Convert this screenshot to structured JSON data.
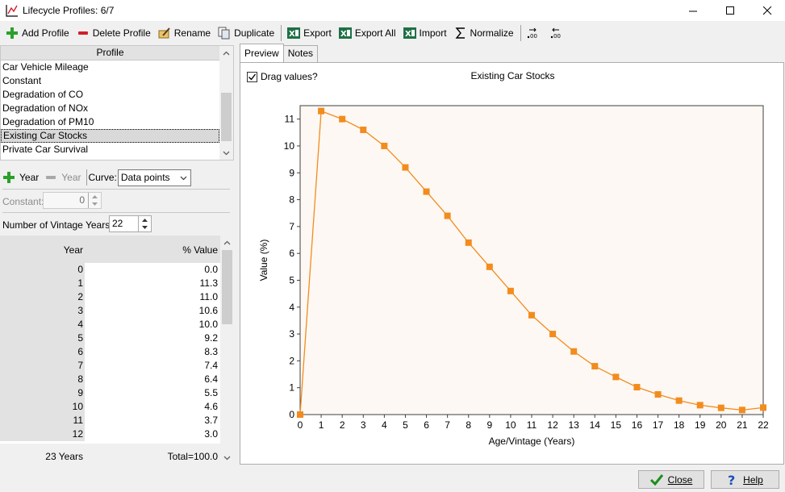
{
  "window": {
    "title": "Lifecycle Profiles: 6/7"
  },
  "toolbar": {
    "add_profile": "Add Profile",
    "delete_profile": "Delete Profile",
    "rename": "Rename",
    "duplicate": "Duplicate",
    "export": "Export",
    "export_all": "Export All",
    "import": "Import",
    "normalize": "Normalize"
  },
  "profiles": {
    "header": "Profile",
    "items": [
      "Car Vehicle Mileage",
      "Constant",
      "Degradation of CO",
      "Degradation of NOx",
      "Degradation of PM10",
      "Existing Car Stocks",
      "Private Car Survival"
    ],
    "selected": "Existing Car Stocks"
  },
  "controls": {
    "add_year": "Year",
    "remove_year": "Year",
    "curve_label": "Curve:",
    "curve_value": "Data points",
    "constant_label": "Constant:",
    "constant_value": "0",
    "vintage_label": "Number of Vintage Years:",
    "vintage_value": "22"
  },
  "table": {
    "col_year": "Year",
    "col_value": "% Value",
    "rows": [
      {
        "year": "0",
        "value": "0.0"
      },
      {
        "year": "1",
        "value": "11.3"
      },
      {
        "year": "2",
        "value": "11.0"
      },
      {
        "year": "3",
        "value": "10.6"
      },
      {
        "year": "4",
        "value": "10.0"
      },
      {
        "year": "5",
        "value": "9.2"
      },
      {
        "year": "6",
        "value": "8.3"
      },
      {
        "year": "7",
        "value": "7.4"
      },
      {
        "year": "8",
        "value": "6.4"
      },
      {
        "year": "9",
        "value": "5.5"
      },
      {
        "year": "10",
        "value": "4.6"
      },
      {
        "year": "11",
        "value": "3.7"
      },
      {
        "year": "12",
        "value": "3.0"
      }
    ],
    "footer_years": "23 Years",
    "footer_total": "Total=100.0"
  },
  "tabs": {
    "preview": "Preview",
    "notes": "Notes"
  },
  "preview": {
    "drag_values": "Drag values?",
    "drag_checked": true
  },
  "buttons": {
    "close": "Close",
    "help": "Help"
  },
  "colors": {
    "series": "#f28c1e",
    "selected_row": "#d9d9d9",
    "header_bg": "#e2e2e2"
  },
  "chart_data": {
    "type": "line",
    "title": "Existing Car Stocks",
    "xlabel": "Age/Vintage (Years)",
    "ylabel": "Value (%)",
    "x": [
      0,
      1,
      2,
      3,
      4,
      5,
      6,
      7,
      8,
      9,
      10,
      11,
      12,
      13,
      14,
      15,
      16,
      17,
      18,
      19,
      20,
      21,
      22
    ],
    "y": [
      0.0,
      11.3,
      11.0,
      10.6,
      10.0,
      9.2,
      8.3,
      7.4,
      6.4,
      5.5,
      4.6,
      3.7,
      3.0,
      2.35,
      1.8,
      1.4,
      1.02,
      0.75,
      0.52,
      0.35,
      0.25,
      0.17,
      0.26
    ],
    "xlim": [
      0,
      22
    ],
    "ylim": [
      0,
      11.5
    ],
    "xticks": [
      0,
      1,
      2,
      3,
      4,
      5,
      6,
      7,
      8,
      9,
      10,
      11,
      12,
      13,
      14,
      15,
      16,
      17,
      18,
      19,
      20,
      21,
      22
    ],
    "yticks": [
      0,
      1,
      2,
      3,
      4,
      5,
      6,
      7,
      8,
      9,
      10,
      11
    ],
    "grid": false,
    "legend": "none"
  }
}
